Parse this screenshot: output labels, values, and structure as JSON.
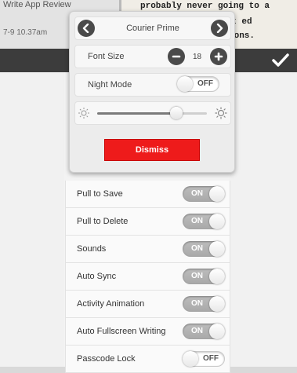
{
  "background": {
    "list_item_title": "Write App Review",
    "list_item_date": "7-9 10.37am",
    "editor_lines": [
      "probably never going to a",
      "new text ed",
      "functions."
    ]
  },
  "popover": {
    "font_name": "Courier Prime",
    "font_size_label": "Font Size",
    "font_size_value": "18",
    "night_mode_label": "Night Mode",
    "night_mode_state": "OFF",
    "brightness": 0.72,
    "dismiss_label": "Dismiss"
  },
  "settings": {
    "rows": [
      {
        "label": "Pull to Save",
        "state": "ON"
      },
      {
        "label": "Pull to Delete",
        "state": "ON"
      },
      {
        "label": "Sounds",
        "state": "ON"
      },
      {
        "label": "Auto Sync",
        "state": "ON"
      },
      {
        "label": "Activity Animation",
        "state": "ON"
      },
      {
        "label": "Auto Fullscreen Writing",
        "state": "ON"
      },
      {
        "label": "Passcode Lock",
        "state": "OFF"
      }
    ]
  },
  "colors": {
    "header": "#3c3c3c",
    "dismiss": "#ee1b1b",
    "toggle_on": "#b3b3b3"
  },
  "icons": [
    "chevron-left-icon",
    "chevron-right-icon",
    "minus-icon",
    "plus-icon",
    "sun-dim-icon",
    "sun-bright-icon",
    "checkmark-icon"
  ]
}
